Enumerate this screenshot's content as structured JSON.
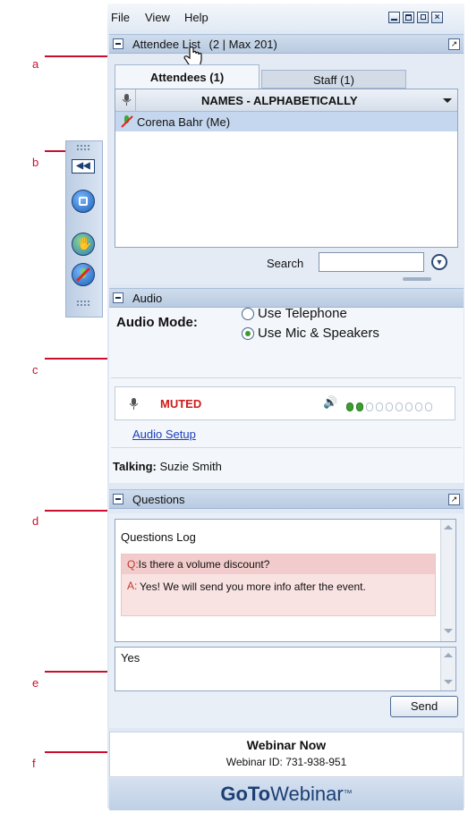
{
  "annotations": [
    "a",
    "b",
    "c",
    "d",
    "e",
    "f"
  ],
  "menu": {
    "items": [
      "File",
      "View",
      "Help"
    ]
  },
  "window_controls": [
    "minimize-icon",
    "maximize-icon",
    "restore-icon",
    "close-icon"
  ],
  "attendee_list": {
    "title": "Attendee List",
    "count_text": "(2 | Max 201)",
    "tabs": [
      {
        "label": "Attendees (1)",
        "active": true
      },
      {
        "label": "Staff (1)",
        "active": false
      }
    ],
    "sort_label": "NAMES - ALPHABETICALLY",
    "attendees": [
      {
        "name": "Corena Bahr (Me)",
        "status_icon": "mic-muted-icon"
      }
    ],
    "search_label": "Search",
    "search_value": ""
  },
  "audio": {
    "title": "Audio",
    "mode_label": "Audio Mode:",
    "options": [
      {
        "label": "Use Telephone",
        "selected": false
      },
      {
        "label": "Use Mic & Speakers",
        "selected": true
      }
    ],
    "mic_status": "MUTED",
    "speaker_level": {
      "filled": 2,
      "total": 9
    },
    "setup_link": "Audio Setup",
    "talking_label": "Talking:",
    "talking_name": "Suzie Smith"
  },
  "questions": {
    "title": "Questions",
    "log_title": "Questions Log",
    "entries": [
      {
        "q_prefix": "Q:",
        "question": "Is there a volume discount?",
        "a_prefix": "A:",
        "answer": "Yes! We will send you more info after the event."
      }
    ],
    "input_value": "Yes",
    "send_label": "Send"
  },
  "footer": {
    "webinar_title": "Webinar Now",
    "webinar_id": "Webinar ID: 731-938-951"
  },
  "brand": {
    "bold": "GoTo",
    "regular": "Webinar",
    "tm": "™"
  },
  "colors": {
    "annotation": "#c8102e",
    "muted": "#d11a1a",
    "link": "#1a3fbf",
    "question_bg": "#f7d8d8"
  }
}
